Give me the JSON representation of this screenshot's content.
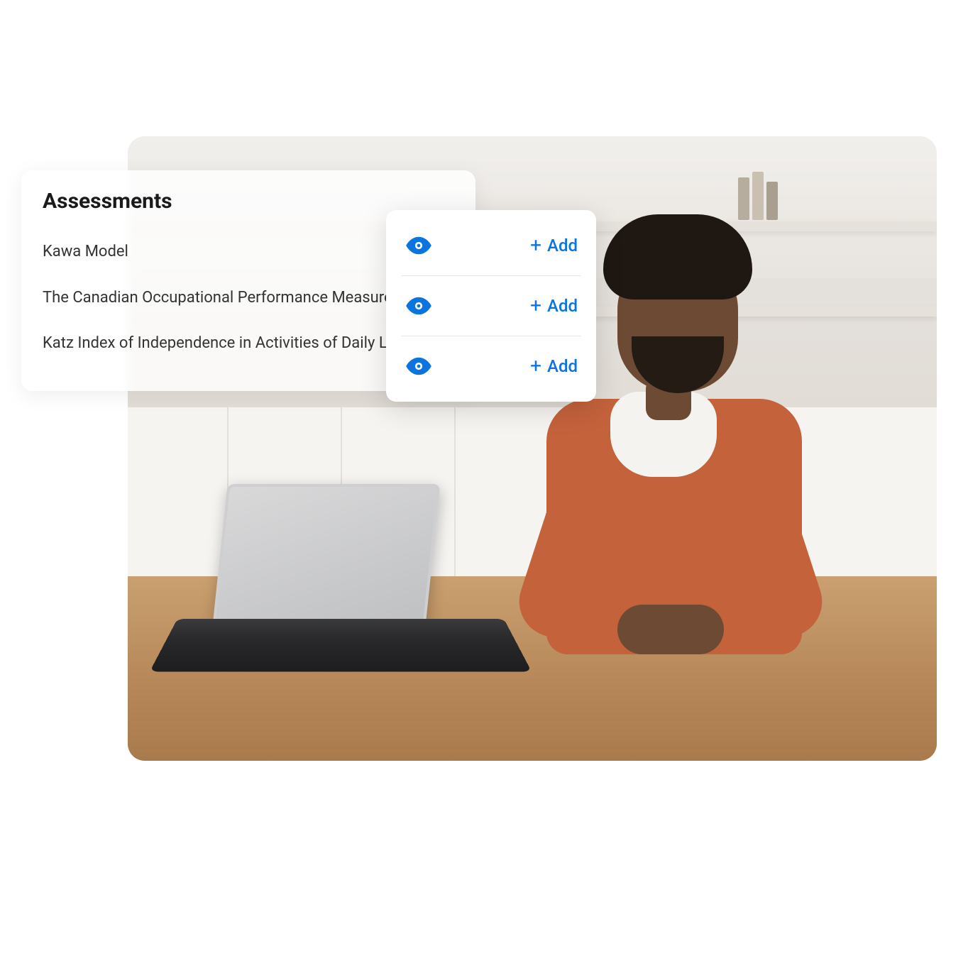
{
  "colors": {
    "accent": "#0b74de"
  },
  "assessments": {
    "heading": "Assessments",
    "items": [
      {
        "label": "Kawa Model"
      },
      {
        "label": "The Canadian Occupational Performance Measure"
      },
      {
        "label": "Katz Index of Independence in Activities of Daily Liv"
      }
    ]
  },
  "actions": {
    "add_label": "Add",
    "rows": [
      {
        "view_icon": "eye-icon",
        "add_label": "Add"
      },
      {
        "view_icon": "eye-icon",
        "add_label": "Add"
      },
      {
        "view_icon": "eye-icon",
        "add_label": "Add"
      }
    ]
  }
}
